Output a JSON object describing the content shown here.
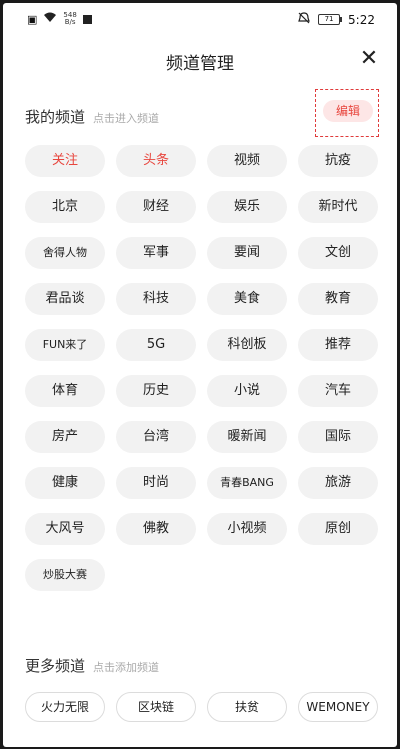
{
  "status_bar": {
    "speed_value": "548",
    "speed_unit": "B/s",
    "battery": "71",
    "time": "5:22"
  },
  "header": {
    "title": "频道管理",
    "close_icon": "close-icon"
  },
  "my_channels": {
    "title": "我的频道",
    "hint": "点击进入频道",
    "edit_label": "编辑",
    "items": [
      {
        "label": "关注",
        "active": true
      },
      {
        "label": "头条",
        "active": true
      },
      {
        "label": "视频"
      },
      {
        "label": "抗疫"
      },
      {
        "label": "北京"
      },
      {
        "label": "财经"
      },
      {
        "label": "娱乐"
      },
      {
        "label": "新时代"
      },
      {
        "label": "舍得人物"
      },
      {
        "label": "军事"
      },
      {
        "label": "要闻"
      },
      {
        "label": "文创"
      },
      {
        "label": "君品谈"
      },
      {
        "label": "科技"
      },
      {
        "label": "美食"
      },
      {
        "label": "教育"
      },
      {
        "label": "FUN来了"
      },
      {
        "label": "5G"
      },
      {
        "label": "科创板"
      },
      {
        "label": "推荐"
      },
      {
        "label": "体育"
      },
      {
        "label": "历史"
      },
      {
        "label": "小说"
      },
      {
        "label": "汽车"
      },
      {
        "label": "房产"
      },
      {
        "label": "台湾"
      },
      {
        "label": "暖新闻"
      },
      {
        "label": "国际"
      },
      {
        "label": "健康"
      },
      {
        "label": "时尚"
      },
      {
        "label": "青春BANG"
      },
      {
        "label": "旅游"
      },
      {
        "label": "大风号"
      },
      {
        "label": "佛教"
      },
      {
        "label": "小视频"
      },
      {
        "label": "原创"
      },
      {
        "label": "炒股大赛"
      }
    ]
  },
  "more_channels": {
    "title": "更多频道",
    "hint": "点击添加频道",
    "items": [
      {
        "label": "火力无限"
      },
      {
        "label": "区块链"
      },
      {
        "label": "扶贫"
      },
      {
        "label": "WEMONEY"
      }
    ]
  },
  "colors": {
    "accent": "#e8463e",
    "chip_bg": "#f2f2f2"
  }
}
